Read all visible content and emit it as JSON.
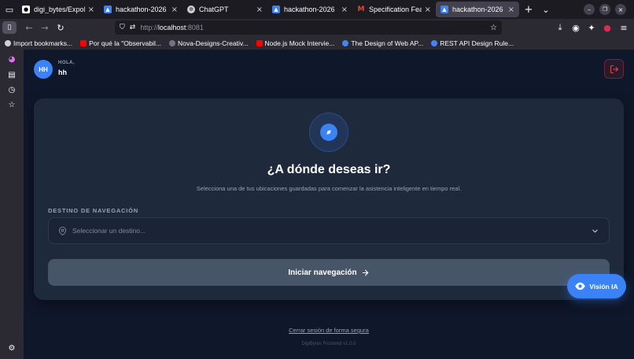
{
  "browser": {
    "tabs": [
      {
        "title": "digi_bytes/ExpoInteg",
        "favicon": "github-icon",
        "active": false
      },
      {
        "title": "hackathon-2026",
        "favicon": "app-icon",
        "active": false
      },
      {
        "title": "ChatGPT",
        "favicon": "chatgpt-icon",
        "active": false
      },
      {
        "title": "hackathon-2026",
        "favicon": "app-icon",
        "active": false
      },
      {
        "title": "Specification Feature",
        "favicon": "gmail-icon",
        "active": false
      },
      {
        "title": "hackathon-2026",
        "favicon": "app-icon",
        "active": true
      }
    ],
    "new_tab_label": "+",
    "url_prefix": "http://",
    "url_host": "localhost",
    "url_port": ":8081",
    "bookmarks": [
      {
        "label": "Import bookmarks...",
        "color": "#cfcfd8"
      },
      {
        "label": "Por qué la \"Observabil...",
        "color": "#ff0000"
      },
      {
        "label": "Nova-Designs-Creativ...",
        "color": "#6e7681"
      },
      {
        "label": "Node.js Mock Intervie...",
        "color": "#ff0000"
      },
      {
        "label": "The Design of Web AP...",
        "color": "#4285f4"
      },
      {
        "label": "REST API Design Rule...",
        "color": "#4285f4"
      }
    ]
  },
  "app": {
    "user": {
      "initials": "HH",
      "greeting": "HOLA,",
      "name": "hh"
    },
    "card": {
      "title": "¿A dónde deseas ir?",
      "subtitle": "Selecciona una de tus ubicaciones guardadas para comenzar la asistencia inteligente en tiempo real.",
      "destination_label": "DESTINO DE NAVEGACIÓN",
      "destination_placeholder": "Seleccionar un destino...",
      "start_button": "Iniciar navegación"
    },
    "vision_button": "Visión IA",
    "signout_link": "Cerrar sesión de forma segura",
    "version": "DigiBytes Frontend v1.0.0",
    "colors": {
      "accent": "#3b82f6",
      "background": "#0f172a",
      "card": "#1e293b",
      "danger": "#ef4444"
    }
  }
}
